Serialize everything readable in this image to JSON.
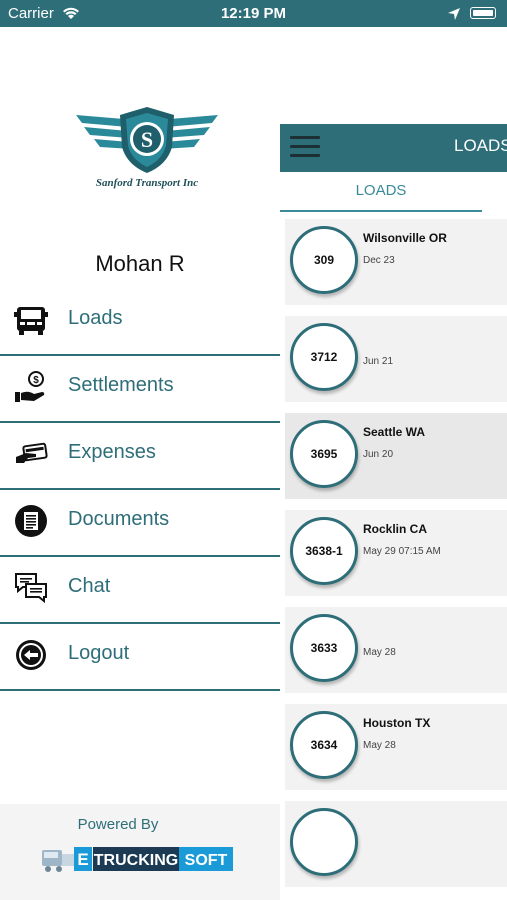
{
  "status_bar": {
    "carrier": "Carrier",
    "time": "12:19 PM"
  },
  "drawer": {
    "company_name": "Sanford Transport Inc",
    "user_name": "Mohan R",
    "menu": [
      {
        "label": "Loads",
        "icon": "truck-icon"
      },
      {
        "label": "Settlements",
        "icon": "money-hand-icon"
      },
      {
        "label": "Expenses",
        "icon": "card-payment-icon"
      },
      {
        "label": "Documents",
        "icon": "document-icon"
      },
      {
        "label": "Chat",
        "icon": "chat-icon"
      },
      {
        "label": "Logout",
        "icon": "logout-icon"
      }
    ],
    "footer": {
      "powered_by": "Powered By",
      "brand_e": "E",
      "brand_trucking": "TRUCKING",
      "brand_soft": "SOFT"
    }
  },
  "main": {
    "title": "LOADS",
    "tab": "LOADS",
    "loads": [
      {
        "id": "309",
        "city": "Wilsonville OR",
        "date": "Dec 23"
      },
      {
        "id": "3712",
        "city": "",
        "date": "Jun 21"
      },
      {
        "id": "3695",
        "city": "Seattle WA",
        "date": "Jun 20"
      },
      {
        "id": "3638-1",
        "city": "Rocklin CA",
        "date": "May 29 07:15 AM"
      },
      {
        "id": "3633",
        "city": "",
        "date": "May 28"
      },
      {
        "id": "3634",
        "city": "Houston TX",
        "date": "May 28"
      }
    ]
  },
  "colors": {
    "accent": "#2e6e79",
    "status_bar": "#2e6e79"
  }
}
